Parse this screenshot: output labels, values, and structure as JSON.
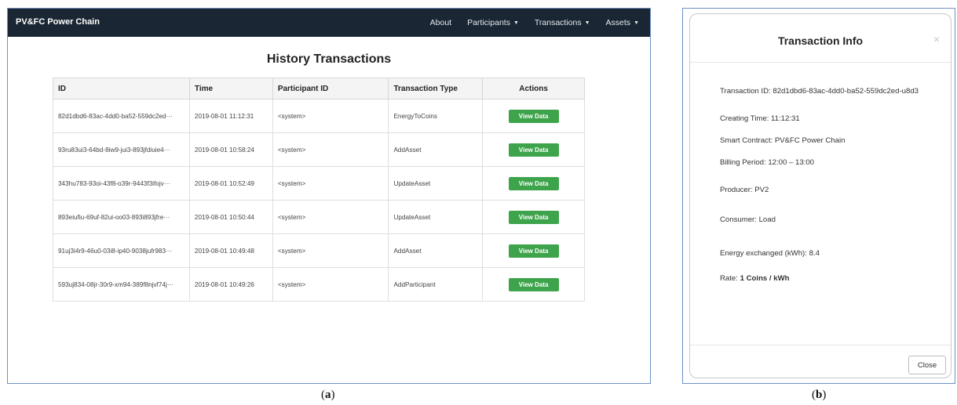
{
  "app": {
    "brand": "PV&FC Power Chain",
    "nav": [
      {
        "label": "About",
        "dropdown": false
      },
      {
        "label": "Participants",
        "dropdown": true
      },
      {
        "label": "Transactions",
        "dropdown": true
      },
      {
        "label": "Assets",
        "dropdown": true
      }
    ]
  },
  "history": {
    "title": "History Transactions",
    "columns": [
      "ID",
      "Time",
      "Participant ID",
      "Transaction Type",
      "Actions"
    ],
    "view_label": "View Data",
    "rows": [
      {
        "id": "82d1dbd6-83ac-4dd0-ba52-559dc2ed···",
        "time": "2019-08-01 11:12:31",
        "participant": "<system>",
        "type": "EnergyToCoins"
      },
      {
        "id": "93ru83ui3-64bd-8iw9-jui3-893jfdiuie4···",
        "time": "2019-08-01 10:58:24",
        "participant": "<system>",
        "type": "AddAsset"
      },
      {
        "id": "343hu783-93oi-43f8-o39r-9443f3ifojv···",
        "time": "2019-08-01 10:52:49",
        "participant": "<system>",
        "type": "UpdateAsset"
      },
      {
        "id": "893eiufiu-69uf-82ui-oo03-893i893jfre···",
        "time": "2019-08-01 10:50:44",
        "participant": "<system>",
        "type": "UpdateAsset"
      },
      {
        "id": "91uj3i4r9-46u0-03i8-ip40-9038jufr983···",
        "time": "2019-08-01 10:49:48",
        "participant": "<system>",
        "type": "AddAsset"
      },
      {
        "id": "593uj834-08jr-30r9-xm94-389f8njvf74j···",
        "time": "2019-08-01 10:49:26",
        "participant": "<system>",
        "type": "AddParticipant"
      }
    ]
  },
  "modal": {
    "title": "Transaction Info",
    "close_x": "×",
    "transaction_id": "Transaction ID: 82d1dbd6-83ac-4dd0-ba52-559dc2ed-u8d3",
    "creating_time": "Creating Time: 11:12:31",
    "smart_contract": "Smart Contract: PV&FC Power Chain",
    "billing_period": "Billing Period: 12:00 – 13:00",
    "producer": "Producer:  PV2",
    "consumer": "Consumer:  Load",
    "energy": "Energy exchanged (kWh): 8.4",
    "rate_label": "Rate: ",
    "rate_value": "1 Coins / kWh",
    "close_button": "Close"
  },
  "captions": {
    "a": "a",
    "b": "b"
  },
  "colors": {
    "navbar": "#1a2633",
    "view_button": "#3ea44c",
    "panel_border": "#6f8fc4"
  }
}
